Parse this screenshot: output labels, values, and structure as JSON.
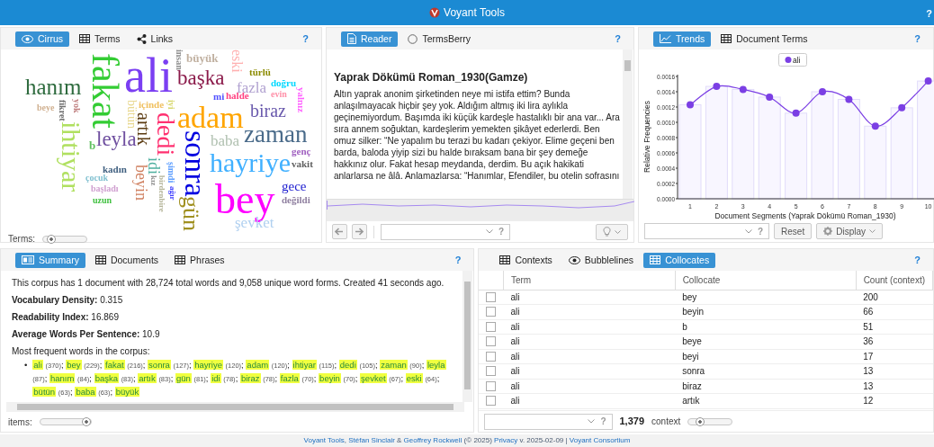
{
  "app": {
    "title": "Voyant Tools",
    "help": "?"
  },
  "cirrus": {
    "tabs": [
      {
        "label": "Cirrus",
        "kind": "eye",
        "selected": true
      },
      {
        "label": "Terms",
        "kind": "grid",
        "selected": false
      },
      {
        "label": "Links",
        "kind": "share",
        "selected": false
      }
    ],
    "help": "?",
    "words": [
      {
        "text": "fakat",
        "color": "#33cc33",
        "vertical": true
      },
      {
        "text": "ali",
        "color": "#7b3ff2",
        "vertical": false
      },
      {
        "text": "insan",
        "color": "#909090",
        "vertical": true
      },
      {
        "text": "büyük",
        "color": "#c0b0a0",
        "vertical": false
      },
      {
        "text": "eski",
        "color": "#ffb0b0",
        "vertical": true
      },
      {
        "text": "başka",
        "color": "#8b1a4a",
        "vertical": false
      },
      {
        "text": "türlü",
        "color": "#8b8b00",
        "vertical": false
      },
      {
        "text": "hanım",
        "color": "#2e6b3e",
        "vertical": false
      },
      {
        "text": "fazla",
        "color": "#b0a0d0",
        "vertical": false
      },
      {
        "text": "doğru",
        "color": "#00d8ff",
        "vertical": false
      },
      {
        "text": "mi",
        "color": "#5050ff",
        "vertical": false
      },
      {
        "text": "halde",
        "color": "#ff4080",
        "vertical": false
      },
      {
        "text": "evin",
        "color": "#ff90a8",
        "vertical": false
      },
      {
        "text": "yalnız",
        "color": "#ff60ff",
        "vertical": true
      },
      {
        "text": "beye",
        "color": "#d0b090",
        "vertical": false
      },
      {
        "text": "fikret",
        "color": "#707070",
        "vertical": true
      },
      {
        "text": "yok",
        "color": "#c08080",
        "vertical": true
      },
      {
        "text": "bütün",
        "color": "#e8d890",
        "vertical": true
      },
      {
        "text": "içinde",
        "color": "#f0c060",
        "vertical": false
      },
      {
        "text": "iyi",
        "color": "#d8d870",
        "vertical": true
      },
      {
        "text": "adam",
        "color": "#ffa500",
        "vertical": false
      },
      {
        "text": "biraz",
        "color": "#6a5aad",
        "vertical": false
      },
      {
        "text": "ihtiyar",
        "color": "#b0e060",
        "vertical": true
      },
      {
        "text": "artık",
        "color": "#5a3a10",
        "vertical": true
      },
      {
        "text": "dedi",
        "color": "#ff3070",
        "vertical": true
      },
      {
        "text": "zaman",
        "color": "#4a6b8a",
        "vertical": false
      },
      {
        "text": "b",
        "color": "#60c060",
        "vertical": false
      },
      {
        "text": "leyla",
        "color": "#7050a0",
        "vertical": false
      },
      {
        "text": "sonra",
        "color": "#0000e0",
        "vertical": true
      },
      {
        "text": "baba",
        "color": "#b0c0b0",
        "vertical": false
      },
      {
        "text": "idi",
        "color": "#50b0a0",
        "vertical": true
      },
      {
        "text": "hayriye",
        "color": "#40b0ff",
        "vertical": false
      },
      {
        "text": "genç",
        "color": "#a060c0",
        "vertical": false
      },
      {
        "text": "vakit",
        "color": "#606060",
        "vertical": false
      },
      {
        "text": "çocuk",
        "color": "#80c0d0",
        "vertical": false
      },
      {
        "text": "kadın",
        "color": "#406080",
        "vertical": false
      },
      {
        "text": "beyin",
        "color": "#d08060",
        "vertical": true
      },
      {
        "text": "kız",
        "color": "#909090",
        "vertical": true
      },
      {
        "text": "birdenbire",
        "color": "#b4b498",
        "vertical": true
      },
      {
        "text": "şimdi",
        "color": "#60a0ff",
        "vertical": true
      },
      {
        "text": "başladı",
        "color": "#d0a0d0",
        "vertical": false
      },
      {
        "text": "ağır",
        "color": "#4040ff",
        "vertical": true
      },
      {
        "text": "bey",
        "color": "#ff00ff",
        "vertical": false
      },
      {
        "text": "gece",
        "color": "#2020d0",
        "vertical": false
      },
      {
        "text": "uzun",
        "color": "#40c040",
        "vertical": false
      },
      {
        "text": "gün",
        "color": "#a09020",
        "vertical": true
      },
      {
        "text": "değildi",
        "color": "#9080a0",
        "vertical": false
      },
      {
        "text": "şevket",
        "color": "#b0d0f0",
        "vertical": false
      }
    ],
    "terms_label": "Terms:",
    "terms_slider": {
      "level": 0.1
    }
  },
  "reader": {
    "tabs": [
      {
        "label": "Reader",
        "kind": "doc",
        "selected": true
      },
      {
        "label": "TermsBerry",
        "kind": "radio",
        "selected": false
      }
    ],
    "help": "?",
    "heading": "Yaprak Dökümü Roman_1930(Gamze)",
    "paragraph": "Altın yaprak anonim şirketinden neye mi istifa ettim? Bunda anlaşılmayacak hiçbir şey yok. Aldığım altmış iki lira aylıkla geçinemiyordum. Başımda iki küçük kardeşle hastalıklı bir ana var... Ara sıra annem soğuktan, kardeşlerim yemekten şikâyet ederlerdi. Ben omuz silker: “Ne yapalım bu terazi bu kadarı çekiyor. Elime geçeni ben barda, baloda yiyip sizi bu halde bıraksam bana bir şey demeğe hakkınız olur. Fakat hesap meydanda, derdim. Bu açık hakikati anlarlarsa ne âlâ. Anlamazlarsa: “Hanımlar, Efendiler, bu otelin sofrasını",
    "search_help": "?"
  },
  "trends": {
    "tabs": [
      {
        "label": "Trends",
        "kind": "trend",
        "selected": true
      },
      {
        "label": "Document Terms",
        "kind": "grid",
        "selected": false
      }
    ],
    "help": "?",
    "chart_data": {
      "type": "line",
      "xlabel": "Document Segments (Yaprak Dökümü Roman_1930)",
      "ylabel": "Relative Frequencies",
      "categories": [
        "1",
        "2",
        "3",
        "4",
        "5",
        "6",
        "7",
        "8",
        "9",
        "10"
      ],
      "series": [
        {
          "type": "bar",
          "color": "#f8f6ff",
          "values": [
            0.00123,
            0.00147,
            0.00143,
            0.00133,
            0.00112,
            0.0014,
            0.0013,
            0.00095,
            0.00119,
            0.00154
          ]
        },
        {
          "type": "line",
          "name": "ali",
          "color": "#7b3fe4",
          "marker": true,
          "values": [
            0.00123,
            0.00147,
            0.00143,
            0.00133,
            0.00112,
            0.0014,
            0.0013,
            0.00095,
            0.00119,
            0.00154
          ]
        }
      ],
      "ylim": [
        0,
        0.0016
      ],
      "yticks": [
        {
          "value": 0,
          "label": "0.0000"
        },
        {
          "value": 0.0002,
          "label": "0.0002"
        },
        {
          "value": 0.0004,
          "label": "0.0004"
        },
        {
          "value": 0.0006,
          "label": "0.0006"
        },
        {
          "value": 0.0008,
          "label": "0.0008"
        },
        {
          "value": 0.001,
          "label": "0.0010"
        },
        {
          "value": 0.0012,
          "label": "0.0012"
        },
        {
          "value": 0.0014,
          "label": "0.0014"
        },
        {
          "value": 0.0016,
          "label": "0.0016"
        }
      ]
    },
    "search_help": "?",
    "reset": "Reset",
    "display": "Display"
  },
  "summary": {
    "tabs": [
      {
        "label": "Summary",
        "kind": "card",
        "selected": true
      },
      {
        "label": "Documents",
        "kind": "grid",
        "selected": false
      },
      {
        "label": "Phrases",
        "kind": "grid",
        "selected": false
      }
    ],
    "help": "?",
    "intro": "This corpus has 1 document with 28,724 total words and 9,058 unique word forms. Created 41 seconds ago.",
    "stats": [
      {
        "label": "Vocabulary Density:",
        "value": "0.315"
      },
      {
        "label": "Readability Index:",
        "value": "16.869"
      },
      {
        "label": "Average Words Per Sentence:",
        "value": "10.9"
      }
    ],
    "frequent_heading": "Most frequent words in the corpus:",
    "bullet": "•",
    "separator": ";",
    "frequent_words": [
      {
        "word": "ali",
        "count": "(370)"
      },
      {
        "word": "bey",
        "count": "(229)"
      },
      {
        "word": "fakat",
        "count": "(216)"
      },
      {
        "word": "sonra",
        "count": "(127)"
      },
      {
        "word": "hayriye",
        "count": "(120)"
      },
      {
        "word": "adam",
        "count": "(120)"
      },
      {
        "word": "ihtiyar",
        "count": "(115)"
      },
      {
        "word": "dedi",
        "count": "(105)"
      },
      {
        "word": "zaman",
        "count": "(90)"
      },
      {
        "word": "leyla",
        "count": "(87)"
      },
      {
        "word": "hanım",
        "count": "(84)"
      },
      {
        "word": "başka",
        "count": "(83)"
      },
      {
        "word": "artık",
        "count": "(83)"
      },
      {
        "word": "gün",
        "count": "(81)"
      },
      {
        "word": "idi",
        "count": "(78)"
      },
      {
        "word": "biraz",
        "count": "(78)"
      },
      {
        "word": "fazla",
        "count": "(70)"
      },
      {
        "word": "beyin",
        "count": "(70)"
      },
      {
        "word": "şevket",
        "count": "(67)"
      },
      {
        "word": "eski",
        "count": "(64)"
      },
      {
        "word": "bütün",
        "count": "(63)"
      },
      {
        "word": "baba",
        "count": "(63)"
      },
      {
        "word": "büyük"
      }
    ],
    "items_label": "items:",
    "items_slider": {
      "level": 1
    }
  },
  "collocates": {
    "tabs": [
      {
        "label": "Contexts",
        "kind": "grid",
        "selected": false
      },
      {
        "label": "Bubblelines",
        "kind": "eye",
        "selected": false
      },
      {
        "label": "Collocates",
        "kind": "grid",
        "selected": true
      }
    ],
    "help": "?",
    "columns": [
      "Term",
      "Collocate",
      "Count (context)"
    ],
    "rows": [
      {
        "checked": false,
        "term": "ali",
        "collocate": "bey",
        "count": "200"
      },
      {
        "checked": false,
        "term": "ali",
        "collocate": "beyin",
        "count": "66"
      },
      {
        "checked": false,
        "term": "ali",
        "collocate": "b",
        "count": "51"
      },
      {
        "checked": false,
        "term": "ali",
        "collocate": "beye",
        "count": "36"
      },
      {
        "checked": false,
        "term": "ali",
        "collocate": "beyi",
        "count": "17"
      },
      {
        "checked": false,
        "term": "ali",
        "collocate": "sonra",
        "count": "13"
      },
      {
        "checked": false,
        "term": "ali",
        "collocate": "biraz",
        "count": "13"
      },
      {
        "checked": false,
        "term": "ali",
        "collocate": "artık",
        "count": "12"
      }
    ],
    "search_help": "?",
    "total": "1,379",
    "context_label": "context",
    "context_slider": {
      "level": 0.2
    }
  },
  "footer": [
    {
      "text": "Voyant Tools",
      "link": true
    },
    {
      "text": ", ",
      "link": false
    },
    {
      "text": "Stéfan Sinclair",
      "link": true
    },
    {
      "text": " & ",
      "link": false
    },
    {
      "text": "Geoffrey Rockwell",
      "link": true
    },
    {
      "text": " (© 2025) ",
      "link": false
    },
    {
      "text": "Privacy",
      "link": true
    },
    {
      "text": " v. 2025-02-09 | ",
      "link": false
    },
    {
      "text": "Voyant Consortium",
      "link": true
    }
  ]
}
